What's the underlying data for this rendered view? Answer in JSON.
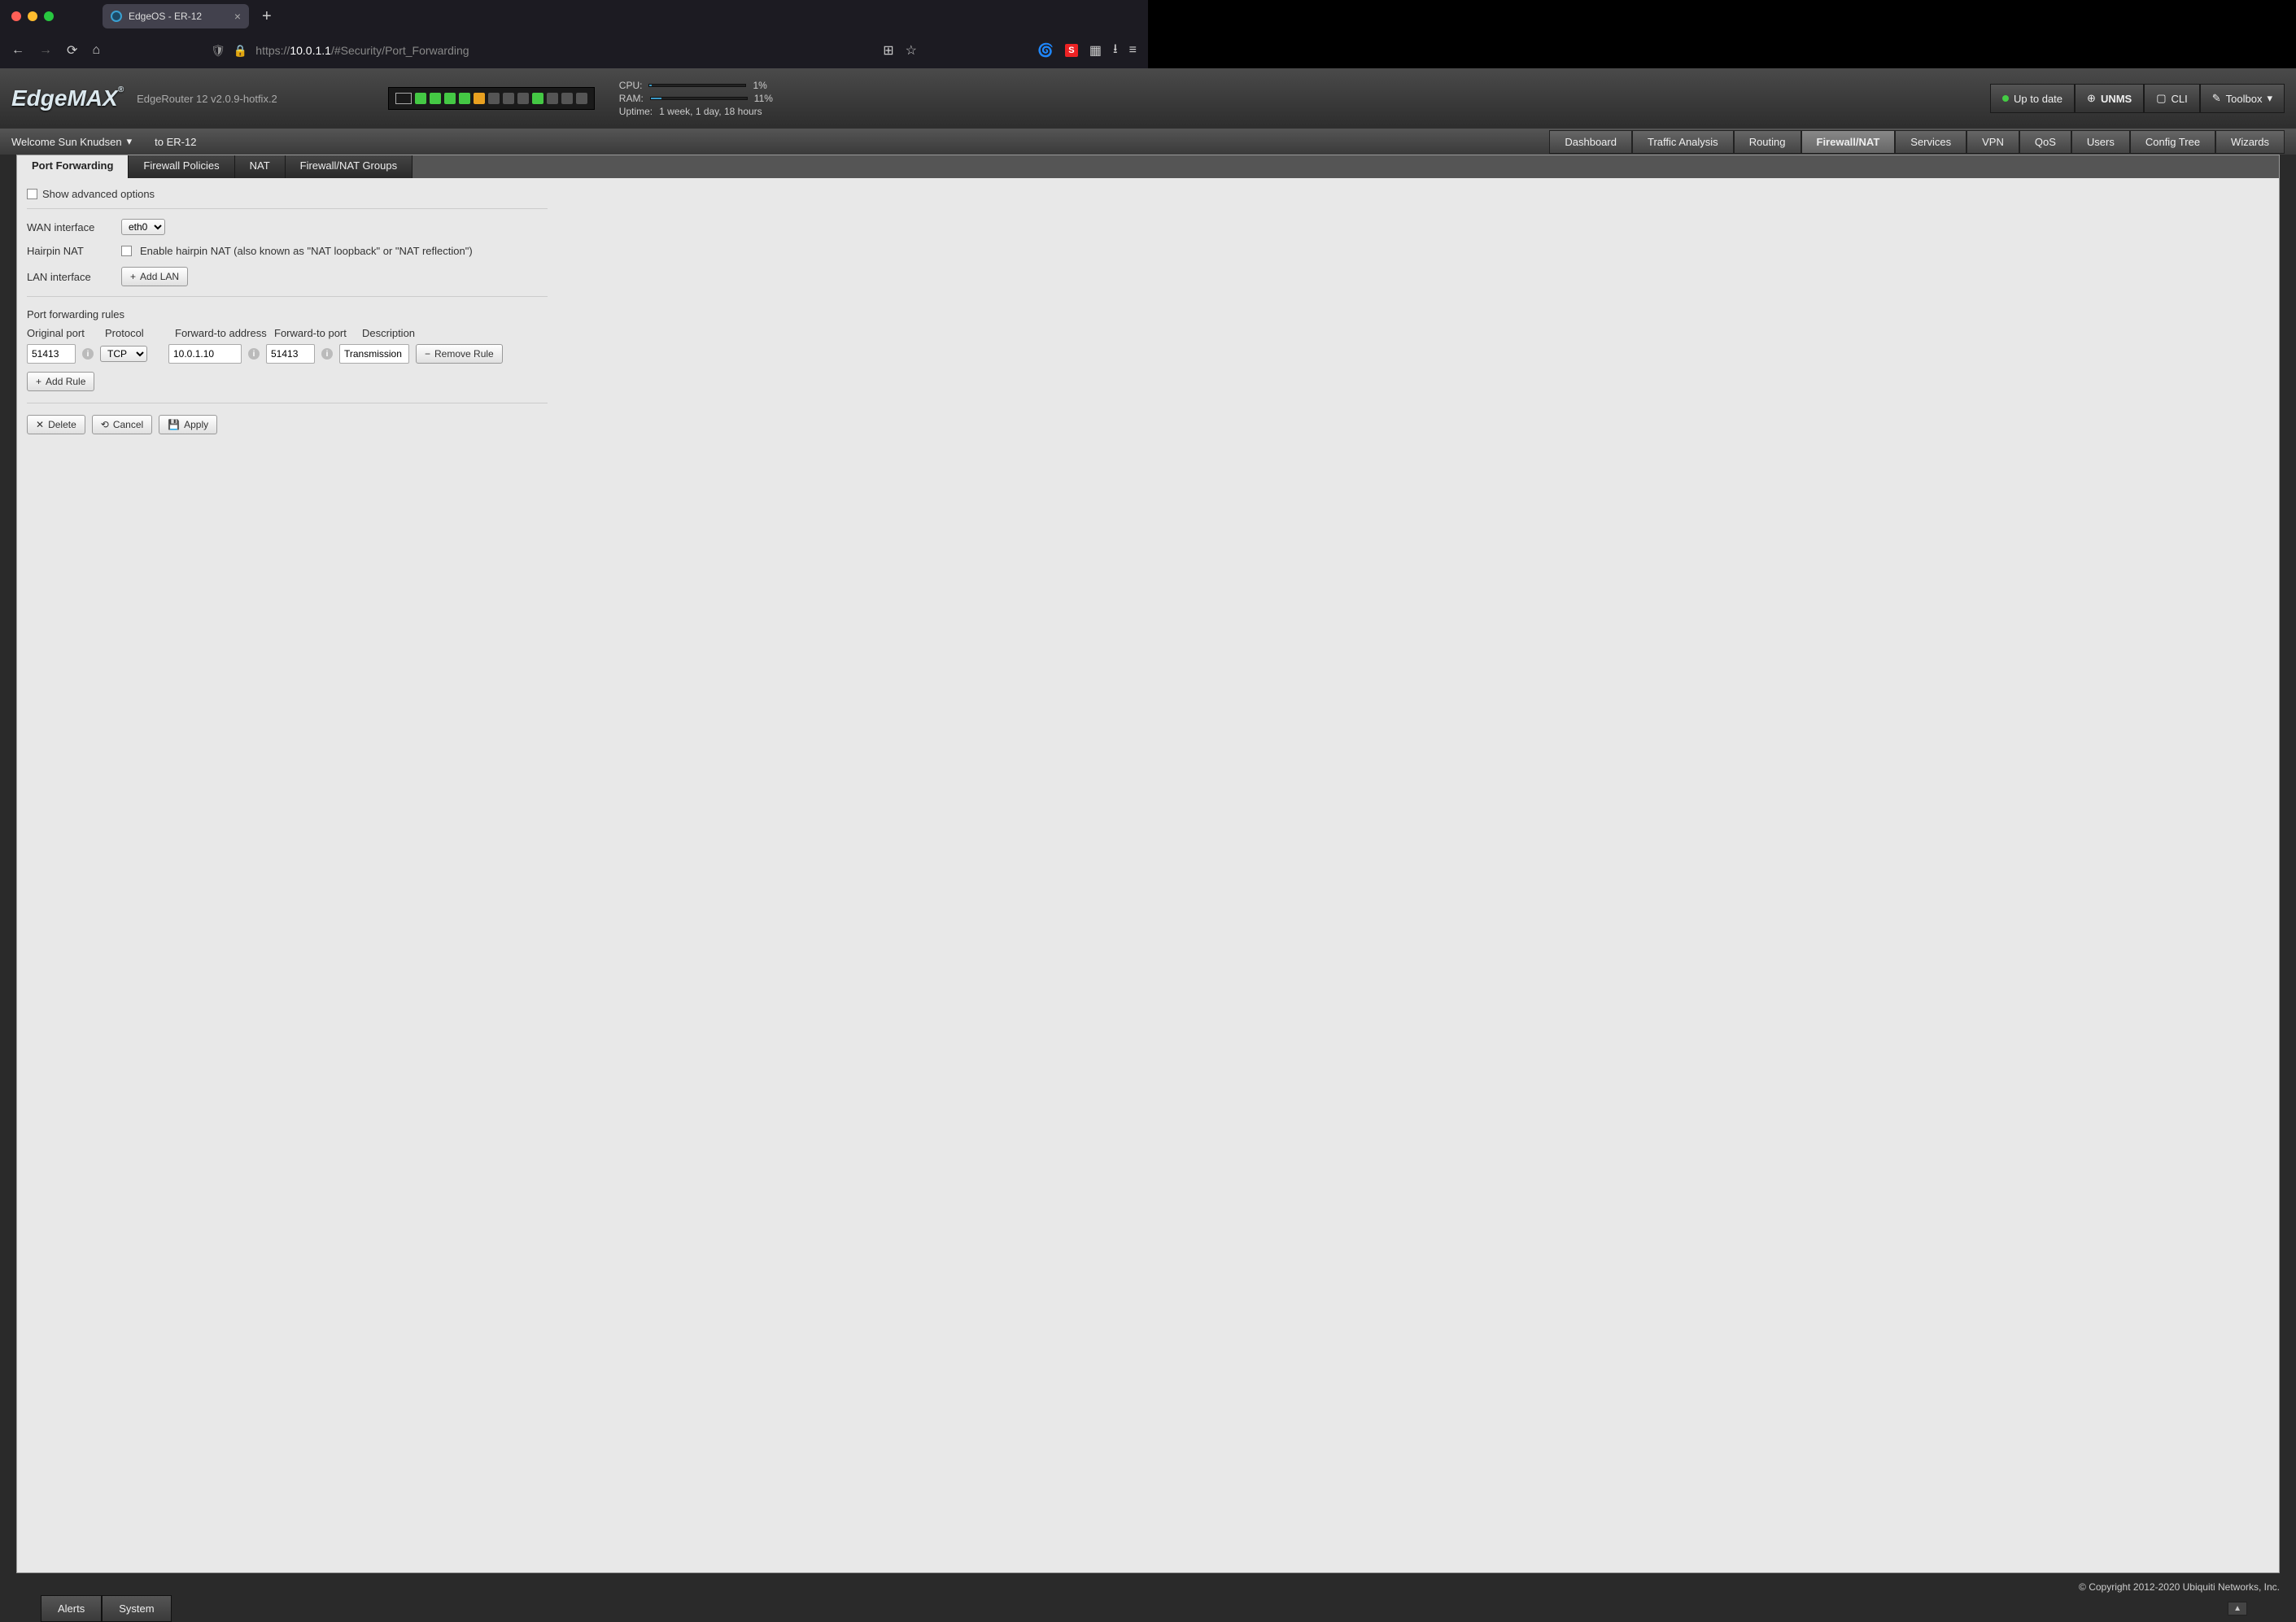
{
  "browser": {
    "tab_title": "EdgeOS - ER-12",
    "url_prefix": "https://",
    "url_host": "10.0.1.1",
    "url_path": "/#Security/Port_Forwarding"
  },
  "header": {
    "logo": "EdgeMAX",
    "device": "EdgeRouter 12 v2.0.9-hotfix.2",
    "stats": {
      "cpu_label": "CPU:",
      "cpu_pct": "1%",
      "ram_label": "RAM:",
      "ram_pct": "11%",
      "uptime_label": "Uptime:",
      "uptime_val": "1 week, 1 day, 18 hours"
    },
    "uptodate": "Up to date",
    "unms": "UNMS",
    "cli": "CLI",
    "toolbox": "Toolbox"
  },
  "subheader": {
    "welcome": "Welcome Sun Knudsen",
    "to": "to ER-12",
    "navtabs": [
      "Dashboard",
      "Traffic Analysis",
      "Routing",
      "Firewall/NAT",
      "Services",
      "VPN",
      "QoS",
      "Users",
      "Config Tree",
      "Wizards"
    ],
    "active_navtab": "Firewall/NAT"
  },
  "subtabs": {
    "items": [
      "Port Forwarding",
      "Firewall Policies",
      "NAT",
      "Firewall/NAT Groups"
    ],
    "active": "Port Forwarding"
  },
  "panel": {
    "adv_label": "Show advanced options",
    "wan_label": "WAN interface",
    "wan_value": "eth0",
    "hairpin_label": "Hairpin NAT",
    "hairpin_text": "Enable hairpin NAT (also known as \"NAT loopback\" or \"NAT reflection\")",
    "lan_label": "LAN interface",
    "add_lan": "Add LAN",
    "rules_title": "Port forwarding rules",
    "cols": {
      "oport": "Original port",
      "proto": "Protocol",
      "faddr": "Forward-to address",
      "fport": "Forward-to port",
      "desc": "Description"
    },
    "rule": {
      "oport": "51413",
      "proto": "TCP",
      "faddr": "10.0.1.10",
      "fport": "51413",
      "desc": "Transmission"
    },
    "remove_rule": "Remove Rule",
    "add_rule": "Add Rule",
    "delete": "Delete",
    "cancel": "Cancel",
    "apply": "Apply"
  },
  "footer": {
    "alerts": "Alerts",
    "system": "System",
    "copyright": "© Copyright 2012-2020 Ubiquiti Networks, Inc."
  },
  "icons": {
    "plus": "+",
    "minus": "−",
    "times": "✕",
    "reload": "⟲",
    "disk": "💾"
  }
}
